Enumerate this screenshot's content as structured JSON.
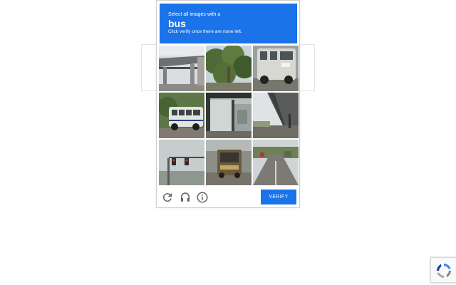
{
  "challenge": {
    "instruction": "Select all images with a",
    "keyword": "bus",
    "hint": "Click verify once there are none left.",
    "verify_label": "VERIFY",
    "tiles": [
      {
        "subject": "overpass"
      },
      {
        "subject": "trees"
      },
      {
        "subject": "van"
      },
      {
        "subject": "bus"
      },
      {
        "subject": "bus-shelter"
      },
      {
        "subject": "overpass"
      },
      {
        "subject": "traffic-light"
      },
      {
        "subject": "bus"
      },
      {
        "subject": "street"
      }
    ]
  },
  "icons": {
    "reload": "reload-icon",
    "audio": "headphones-icon",
    "info": "info-icon",
    "badge": "recaptcha-logo-icon"
  },
  "colors": {
    "accent": "#1a73e8",
    "icon_gray": "#5f6368"
  }
}
